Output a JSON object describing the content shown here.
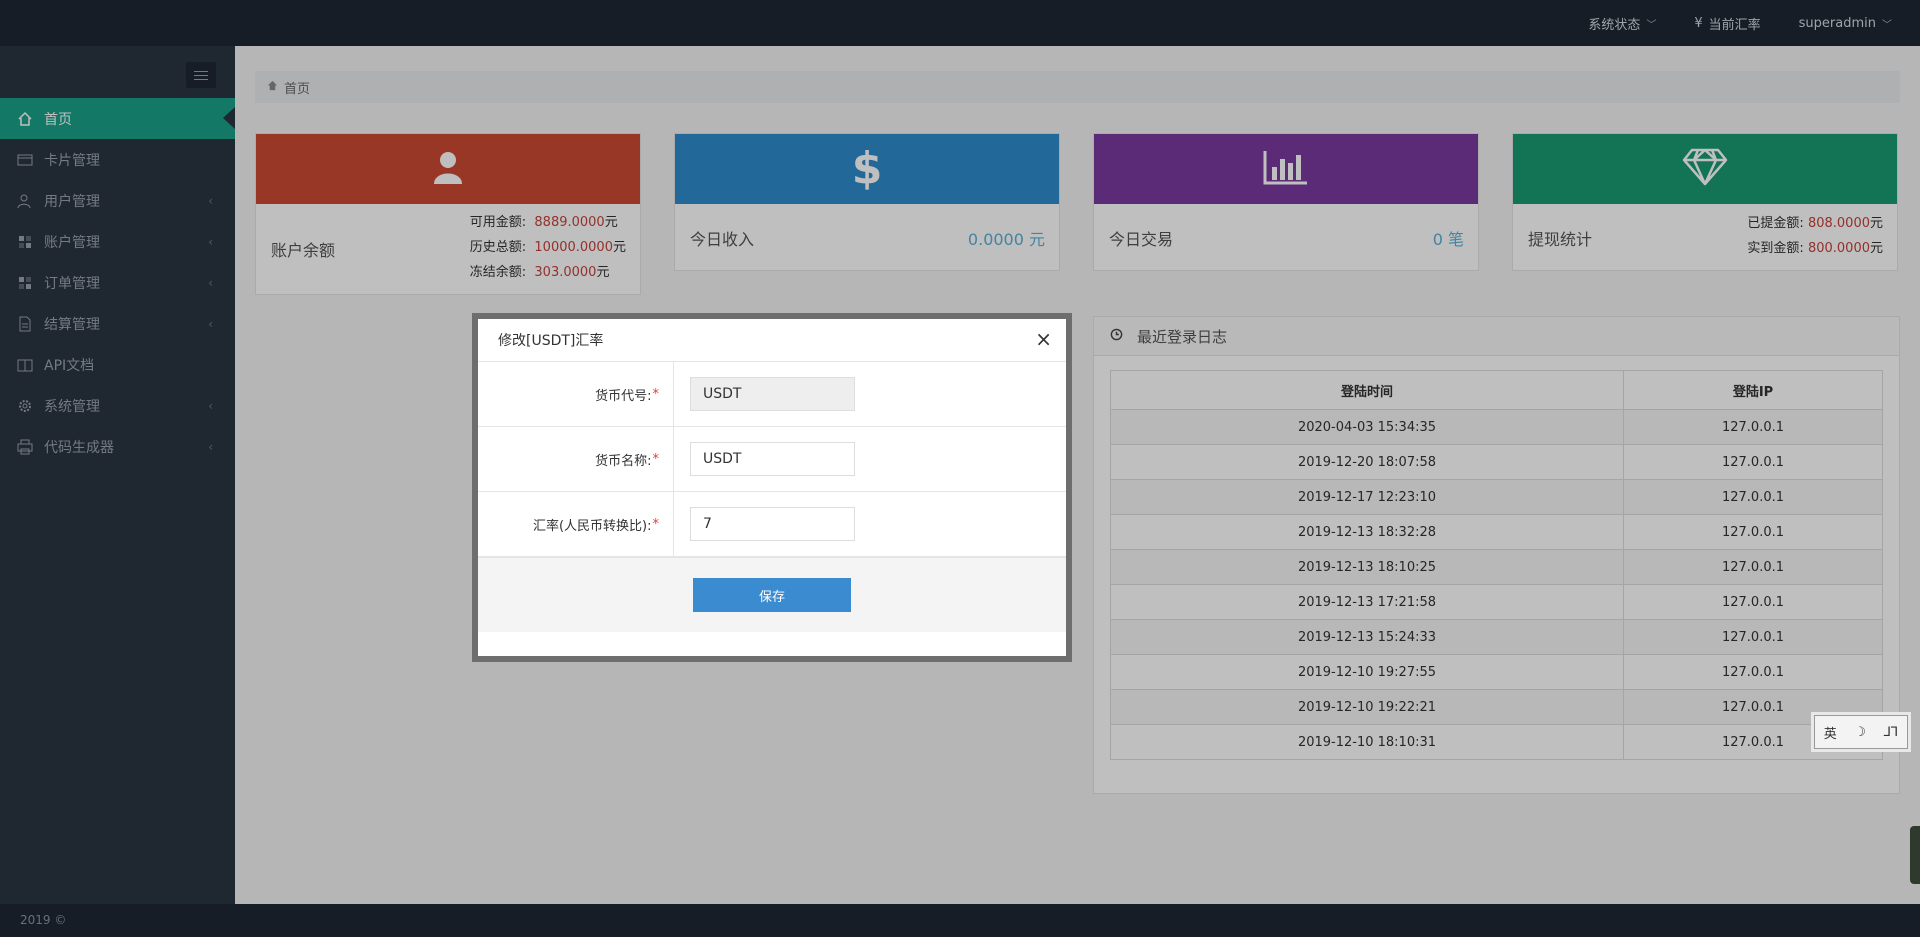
{
  "topbar": {
    "system_status": "系统状态",
    "exchange_rate": "当前汇率",
    "yen_symbol": "¥",
    "user": "superadmin"
  },
  "sidebar": {
    "items": [
      {
        "label": "首页",
        "icon": "home-icon",
        "active": true
      },
      {
        "label": "卡片管理",
        "icon": "card-icon"
      },
      {
        "label": "用户管理",
        "icon": "users-icon",
        "expandable": true
      },
      {
        "label": "账户管理",
        "icon": "grid-icon",
        "expandable": true
      },
      {
        "label": "订单管理",
        "icon": "grid-icon",
        "expandable": true
      },
      {
        "label": "结算管理",
        "icon": "file-icon",
        "expandable": true
      },
      {
        "label": "API文档",
        "icon": "book-icon"
      },
      {
        "label": "系统管理",
        "icon": "gear-icon",
        "expandable": true
      },
      {
        "label": "代码生成器",
        "icon": "printer-icon",
        "expandable": true
      }
    ],
    "footer": "2019 ©"
  },
  "breadcrumb": {
    "home": "首页"
  },
  "cards": {
    "balance": {
      "label": "账户余额",
      "available_label": "可用金额:",
      "available_value": "8889.0000",
      "history_label": "历史总额:",
      "history_value": "10000.0000",
      "frozen_label": "冻结余额:",
      "frozen_value": "303.0000",
      "unit": "元"
    },
    "income": {
      "label": "今日收入",
      "value": "0.0000 元"
    },
    "trade": {
      "label": "今日交易",
      "value": "0 笔"
    },
    "withdraw": {
      "label": "提现统计",
      "withdrawn_label": "已提金额:",
      "withdrawn_value": "808.0000",
      "received_label": "实到金额:",
      "received_value": "800.0000",
      "unit": "元"
    }
  },
  "login_log": {
    "title": "最近登录日志",
    "columns": [
      "登陆时间",
      "登陆IP"
    ],
    "rows": [
      [
        "2020-04-03 15:34:35",
        "127.0.0.1"
      ],
      [
        "2019-12-20 18:07:58",
        "127.0.0.1"
      ],
      [
        "2019-12-17 12:23:10",
        "127.0.0.1"
      ],
      [
        "2019-12-13 18:32:28",
        "127.0.0.1"
      ],
      [
        "2019-12-13 18:10:25",
        "127.0.0.1"
      ],
      [
        "2019-12-13 17:21:58",
        "127.0.0.1"
      ],
      [
        "2019-12-13 15:24:33",
        "127.0.0.1"
      ],
      [
        "2019-12-10 19:27:55",
        "127.0.0.1"
      ],
      [
        "2019-12-10 19:22:21",
        "127.0.0.1"
      ],
      [
        "2019-12-10 18:10:31",
        "127.0.0.1"
      ]
    ]
  },
  "modal": {
    "title": "修改[USDT]汇率",
    "close": "×",
    "fields": [
      {
        "label": "货币代号:",
        "value": "USDT",
        "readonly": true
      },
      {
        "label": "货币名称:",
        "value": "USDT"
      },
      {
        "label": "汇率(人民币转换比):",
        "value": "7"
      }
    ],
    "required_mark": "*",
    "save": "保存"
  },
  "ime": {
    "lang": "英",
    "moon": "☽",
    "mode": "⅃⅂"
  },
  "colors": {
    "accent": "#1aa289",
    "card_balance": "#cd4a35",
    "card_income": "#2e8ccd",
    "card_trade": "#7b3aa0",
    "card_withdraw": "#199a72",
    "save_button": "#3b8bd1"
  }
}
